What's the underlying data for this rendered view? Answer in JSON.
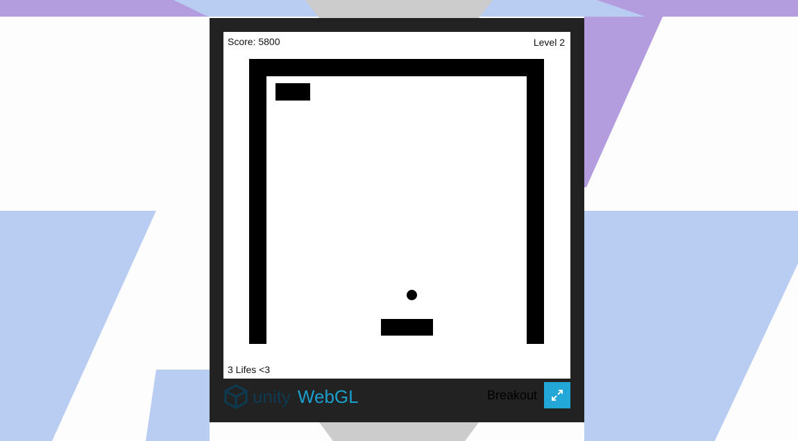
{
  "game": {
    "score_text": "Score: 5800",
    "level_text": "Level 2",
    "lives_text": "3 Lifes <3"
  },
  "footer": {
    "logo_word": "unity",
    "logo_product": "WebGL",
    "game_title": "Breakout",
    "fullscreen_icon": "fullscreen-icon"
  },
  "colors": {
    "page_bg": "#fdfdfd",
    "bg_purple": "#b39ddf",
    "bg_blue": "#b9cdf3",
    "bg_gray": "#cccccc",
    "frame": "#222222",
    "accent": "#22a7d8"
  }
}
